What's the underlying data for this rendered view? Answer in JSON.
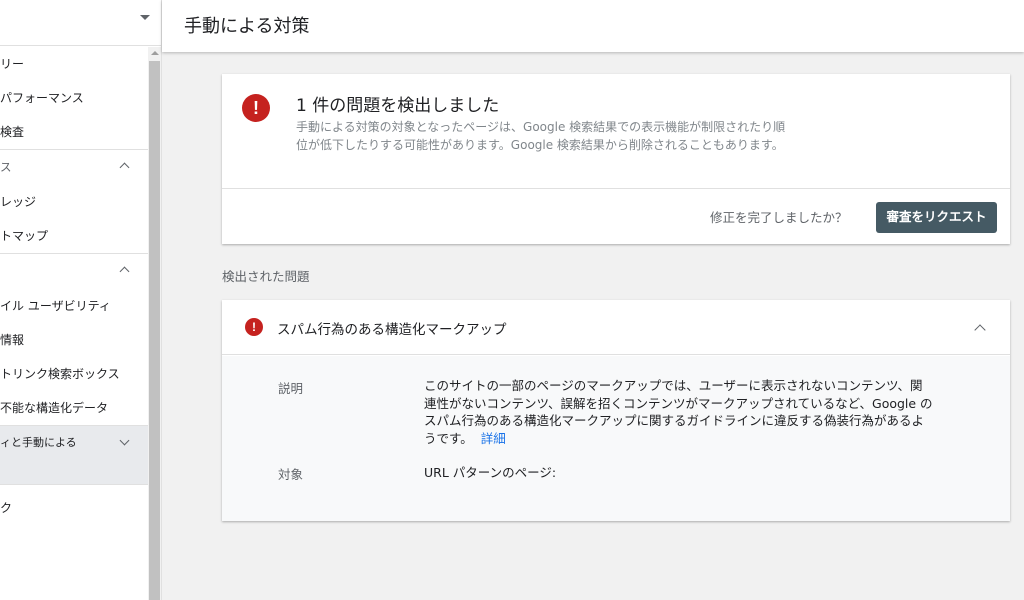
{
  "sidebar": {
    "items": [
      {
        "type": "item",
        "label": "リー"
      },
      {
        "type": "item",
        "label": "パフォーマンス"
      },
      {
        "type": "item",
        "label": "検査"
      },
      {
        "type": "section",
        "label": "ス",
        "chevron": "up"
      },
      {
        "type": "item",
        "label": "レッジ"
      },
      {
        "type": "item",
        "label": "トマップ"
      },
      {
        "type": "section",
        "label": "",
        "chevron": "up"
      },
      {
        "type": "item",
        "label": "イル ユーザビリティ"
      },
      {
        "type": "item",
        "label": "情報"
      },
      {
        "type": "item",
        "label": "トリンク検索ボックス"
      },
      {
        "type": "item",
        "label": "不能な構造化データ"
      },
      {
        "type": "active-section",
        "label": "ィと手動による",
        "chevron": "down"
      },
      {
        "type": "item",
        "label": "ク"
      }
    ]
  },
  "header": {
    "title": "手動による対策"
  },
  "summary": {
    "icon": "error-icon",
    "icon_glyph": "!",
    "title": "1 件の問題を検出しました",
    "description": "手動による対策の対象となったページは、Google 検索結果での表示機能が制限されたり順位が低下したりする可能性があります。Google 検索結果から削除されることもあります。",
    "fix_question": "修正を完了しましたか？",
    "request_button": "審査をリクエスト"
  },
  "detected_label": "検出された問題",
  "issue": {
    "icon": "error-icon",
    "icon_glyph": "!",
    "title": "スパム行為のある構造化マークアップ",
    "description_label": "説明",
    "description_text": "このサイトの一部のページのマークアップでは、ユーザーに表示されないコンテンツ、関連性がないコンテンツ、誤解を招くコンテンツがマークアップされているなど、Google のスパム行為のある構造化マークアップに関するガイドラインに違反する偽装行為があるようです。",
    "details_link": "詳細",
    "target_label": "対象",
    "target_value": "URL パターンのページ:"
  },
  "colors": {
    "error": "#c5221f",
    "button": "#455a64",
    "link": "#1a73e8"
  }
}
